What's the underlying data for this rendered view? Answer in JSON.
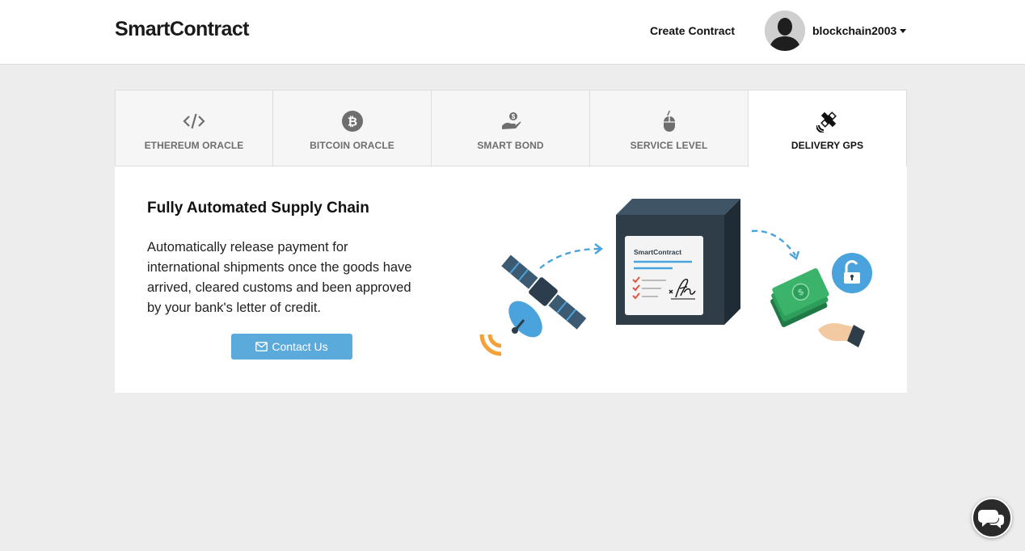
{
  "header": {
    "logo": "SmartContract",
    "create_contract": "Create Contract",
    "username": "blockchain2003"
  },
  "tabs": [
    {
      "label": "ETHEREUM ORACLE",
      "icon": "code-icon",
      "active": false
    },
    {
      "label": "BITCOIN ORACLE",
      "icon": "bitcoin-icon",
      "active": false
    },
    {
      "label": "SMART BOND",
      "icon": "money-hand-icon",
      "active": false
    },
    {
      "label": "SERVICE LEVEL",
      "icon": "mouse-icon",
      "active": false
    },
    {
      "label": "DELIVERY GPS",
      "icon": "satellite-icon",
      "active": true
    }
  ],
  "content": {
    "title": "Fully Automated Supply Chain",
    "description": "Automatically release payment for international shipments once the goods have arrived, cleared customs and been approved by your bank's letter of credit.",
    "contact_button": "Contact Us",
    "illustration_doc_label": "SmartContract"
  },
  "colors": {
    "accent": "#5aabdc",
    "satellite_signal": "#f5a13a",
    "money_green": "#2e9e5b",
    "box_dark": "#2e3d48"
  }
}
